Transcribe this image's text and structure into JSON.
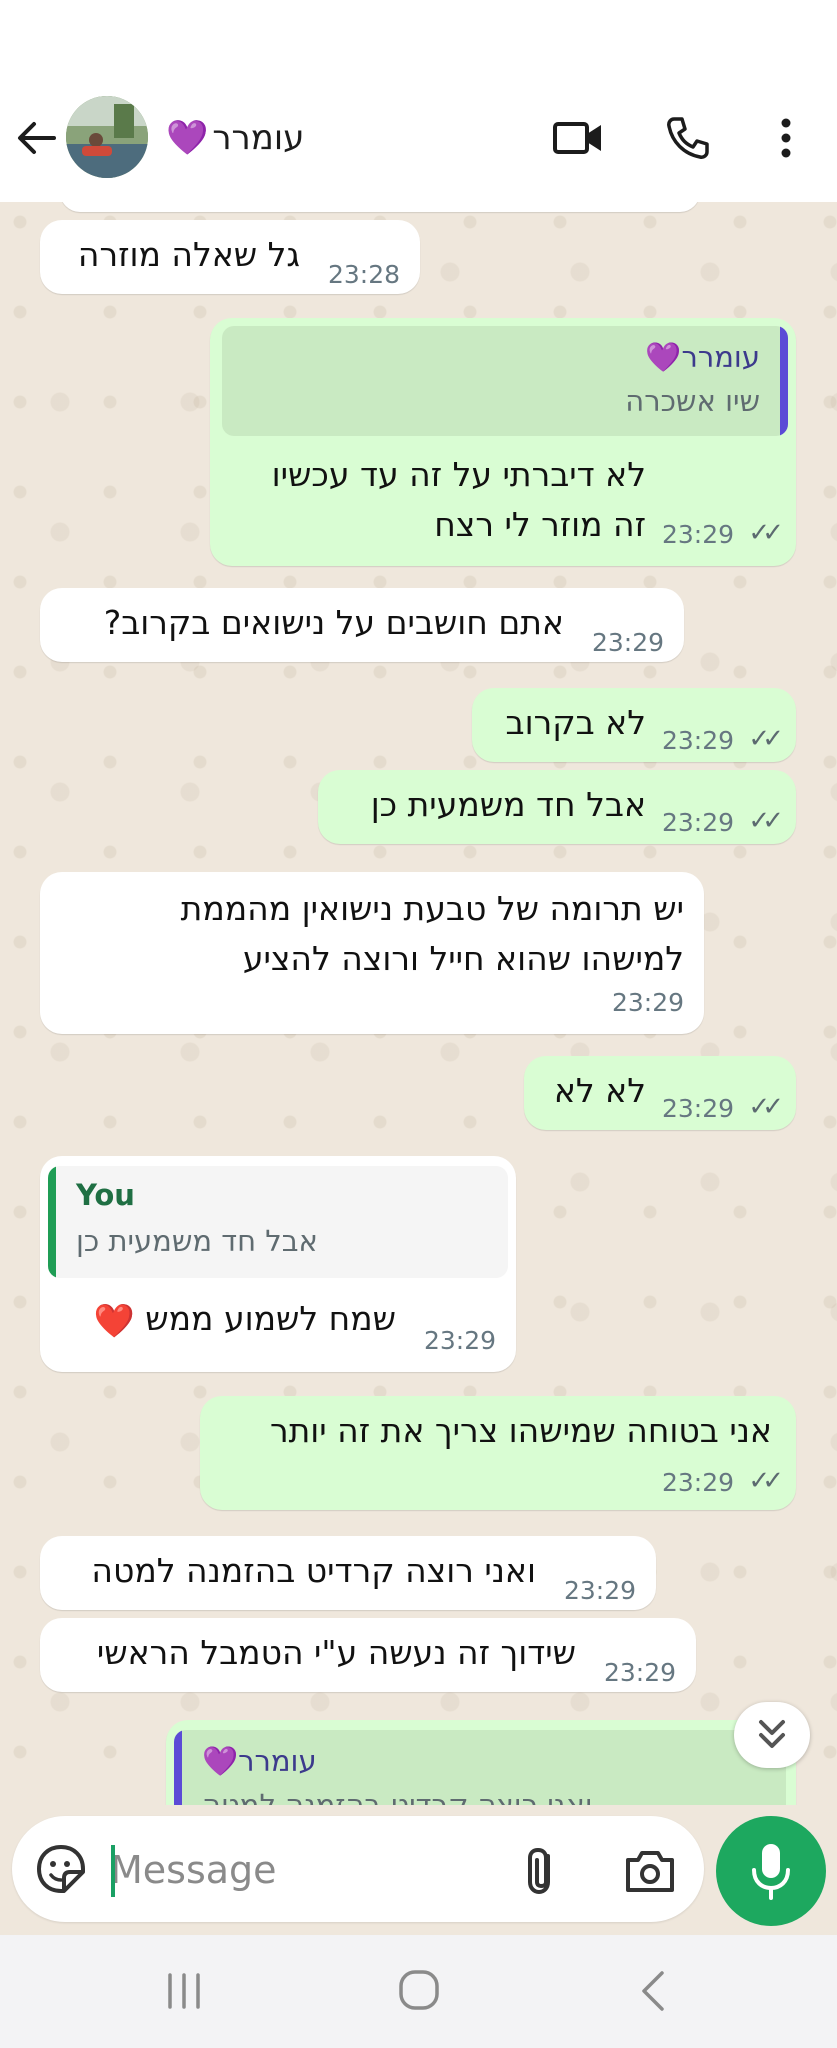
{
  "header": {
    "contact_name": "עומרר",
    "name_emoji": "💜",
    "icons": [
      "back-arrow-icon",
      "video-call-icon",
      "voice-call-icon",
      "more-options-icon"
    ]
  },
  "messages": [
    {
      "dir": "in",
      "text": "גל שאלה מוזרה",
      "time": "23:28"
    },
    {
      "dir": "out",
      "quote_author": "עומרר",
      "quote_emoji": "💜",
      "quote_text": "שיו אשכרה",
      "lines": [
        "לא דיברתי על זה עד עכשיו",
        "זה מוזר לי רצח"
      ],
      "time": "23:29"
    },
    {
      "dir": "in",
      "text": "אתם חושבים על נישואים בקרוב?",
      "time": "23:29"
    },
    {
      "dir": "out",
      "text": "לא בקרוב",
      "time": "23:29"
    },
    {
      "dir": "out",
      "text": "אבל חד משמעית כן",
      "time": "23:29"
    },
    {
      "dir": "in",
      "lines": [
        "יש תרומה של טבעת נישואין מהממת",
        "למישהו שהוא חייל ורוצה להציע"
      ],
      "time": "23:29"
    },
    {
      "dir": "out",
      "text": "לא לא",
      "time": "23:29"
    },
    {
      "dir": "in",
      "quote_author": "You",
      "quote_text": "אבל חד משמעית כן",
      "text": "שמח לשמוע ממש",
      "emoji": "❤️",
      "time": "23:29"
    },
    {
      "dir": "out",
      "text": "אני בטוחה שמישהו צריך את זה יותר",
      "time": "23:29"
    },
    {
      "dir": "in",
      "text": "ואני רוצה קרדיט בהזמנה למטה",
      "time": "23:29"
    },
    {
      "dir": "in",
      "text": "שידוך זה נעשה ע\"י הטמבל הראשי",
      "time": "23:29"
    },
    {
      "dir": "out",
      "quote_author": "עומרר",
      "quote_emoji": "💜",
      "quote_text": "ואני רוצה קרדיט בהזמנה למטה"
    }
  ],
  "input": {
    "placeholder": "Message"
  },
  "colors": {
    "outgoing": "#d9fdd3",
    "incoming": "#ffffff",
    "accent": "#1da85f",
    "chat_bg": "#efe7dc"
  }
}
